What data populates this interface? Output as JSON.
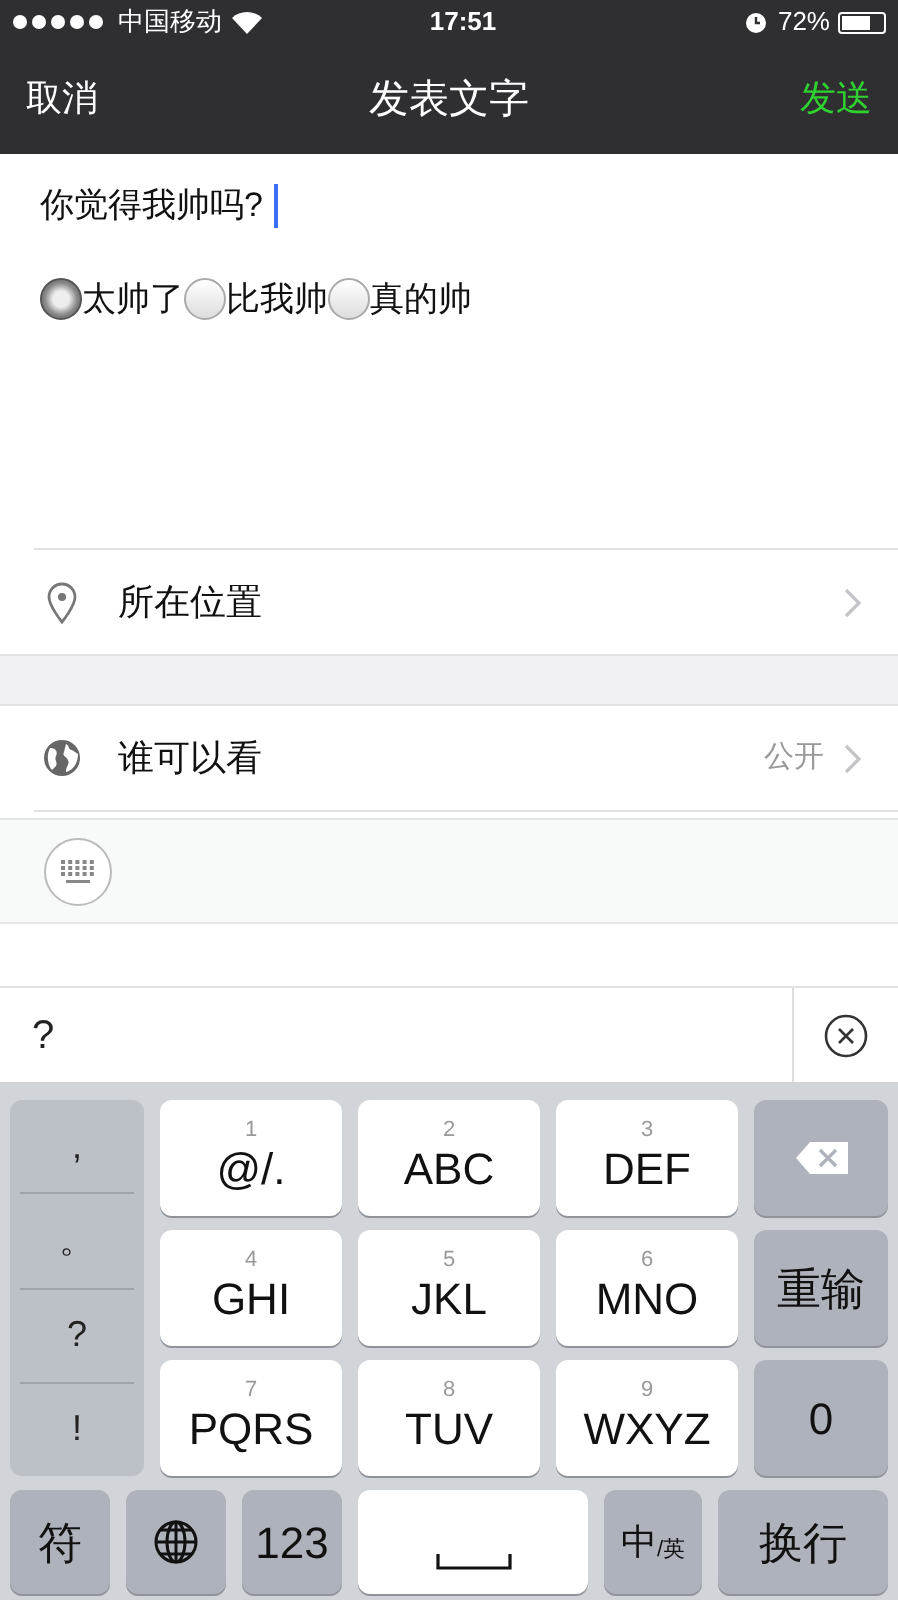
{
  "status_bar": {
    "carrier": "中国移动",
    "time": "17:51",
    "battery": "72%"
  },
  "nav": {
    "cancel": "取消",
    "title": "发表文字",
    "send": "发送"
  },
  "post": {
    "text": "你觉得我帅吗?",
    "options": [
      {
        "label": "太帅了",
        "selected": true
      },
      {
        "label": "比我帅",
        "selected": false
      },
      {
        "label": "真的帅",
        "selected": false
      }
    ]
  },
  "settings": [
    {
      "kind": "location",
      "label": "所在位置"
    },
    {
      "kind": "visibility",
      "label": "谁可以看",
      "value": "公开"
    }
  ],
  "candidate_bar": {
    "text": "?"
  },
  "keyboard": {
    "side_keys": [
      ",",
      "。",
      "?",
      "!"
    ],
    "keys": [
      {
        "kind": "digit",
        "number": "1",
        "letters": "@/."
      },
      {
        "kind": "digit",
        "number": "2",
        "letters": "ABC"
      },
      {
        "kind": "digit",
        "number": "3",
        "letters": "DEF"
      },
      {
        "kind": "delete"
      },
      {
        "kind": "digit",
        "number": "4",
        "letters": "GHI"
      },
      {
        "kind": "digit",
        "number": "5",
        "letters": "JKL"
      },
      {
        "kind": "digit",
        "number": "6",
        "letters": "MNO"
      },
      {
        "kind": "function",
        "label": "重输"
      },
      {
        "kind": "digit",
        "number": "7",
        "letters": "PQRS"
      },
      {
        "kind": "digit",
        "number": "8",
        "letters": "TUV"
      },
      {
        "kind": "digit",
        "number": "9",
        "letters": "WXYZ"
      },
      {
        "kind": "function",
        "label": "0"
      }
    ],
    "bottom": [
      {
        "kind": "function",
        "label": "符"
      },
      {
        "kind": "globe"
      },
      {
        "kind": "function",
        "label": "123"
      },
      {
        "kind": "space"
      },
      {
        "kind": "lang",
        "main": "中",
        "sub": "/英"
      },
      {
        "kind": "function",
        "label": "换行"
      }
    ]
  }
}
